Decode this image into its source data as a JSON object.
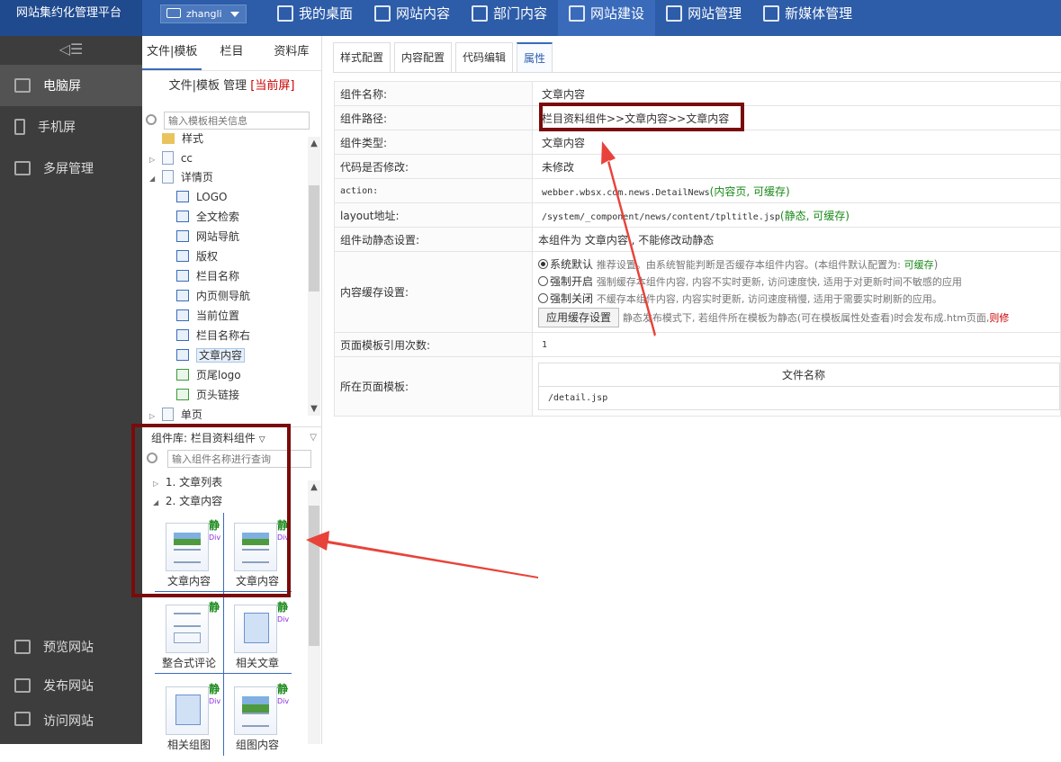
{
  "topbar": {
    "brand": "网站集约化管理平台",
    "user": "zhangli",
    "nav": [
      {
        "label": "我的桌面",
        "icon": "grid-icon"
      },
      {
        "label": "网站内容",
        "icon": "edit-icon"
      },
      {
        "label": "部门内容",
        "icon": "sitemap-icon"
      },
      {
        "label": "网站建设",
        "icon": "build-icon",
        "active": true
      },
      {
        "label": "网站管理",
        "icon": "monitor-gear-icon"
      },
      {
        "label": "新媒体管理",
        "icon": "media-icon"
      }
    ]
  },
  "left_menu": {
    "collapse_glyph": "◁☰",
    "items": [
      {
        "label": "电脑屏",
        "icon": "desktop-icon",
        "active": true
      },
      {
        "label": "手机屏",
        "icon": "phone-icon"
      },
      {
        "label": "多屏管理",
        "icon": "multi-screen-icon"
      }
    ],
    "bottom": [
      {
        "label": "预览网站",
        "icon": "preview-icon"
      },
      {
        "label": "发布网站",
        "icon": "publish-icon"
      },
      {
        "label": "访问网站",
        "icon": "visit-icon"
      }
    ]
  },
  "mid": {
    "tabs": [
      "文件|模板",
      "栏目",
      "资料库"
    ],
    "title": "文件|模板 管理",
    "title_current": "[当前屏]",
    "search_placeholder": "输入模板相关信息",
    "tree": [
      {
        "label": "样式",
        "type": "folder"
      },
      {
        "label": "cc",
        "type": "file",
        "toggle": "▷"
      },
      {
        "label": "详情页",
        "type": "file",
        "toggle": "◢"
      },
      {
        "label": "LOGO",
        "type": "comp"
      },
      {
        "label": "全文检索",
        "type": "comp"
      },
      {
        "label": "网站导航",
        "type": "comp"
      },
      {
        "label": "版权",
        "type": "comp"
      },
      {
        "label": "栏目名称",
        "type": "comp"
      },
      {
        "label": "内页侧导航",
        "type": "comp"
      },
      {
        "label": "当前位置",
        "type": "comp"
      },
      {
        "label": "栏目名称右",
        "type": "comp"
      },
      {
        "label": "文章内容",
        "type": "comp",
        "selected": true
      },
      {
        "label": "页尾logo",
        "type": "green"
      },
      {
        "label": "页头链接",
        "type": "green"
      },
      {
        "label": "单页",
        "type": "file",
        "toggle": "▷"
      }
    ],
    "complib_label": "组件库: 栏目资料组件",
    "complib_search_placeholder": "输入组件名称进行查询",
    "complib_tree": [
      {
        "toggle": "▷",
        "label": "1. 文章列表"
      },
      {
        "toggle": "◢",
        "label": "2. 文章内容"
      }
    ],
    "cards": [
      {
        "label": "文章内容",
        "badge": "静",
        "sub": "Div",
        "kind": "article"
      },
      {
        "label": "文章内容",
        "badge": "静",
        "sub": "Div",
        "kind": "article"
      },
      {
        "label": "整合式评论",
        "badge": "静",
        "sub": "",
        "kind": "form"
      },
      {
        "label": "相关文章",
        "badge": "静",
        "sub": "Div",
        "kind": "book"
      },
      {
        "label": "相关组图",
        "badge": "静",
        "sub": "Div",
        "kind": "book"
      },
      {
        "label": "组图内容",
        "badge": "静",
        "sub": "Div",
        "kind": "gallery"
      }
    ]
  },
  "right": {
    "tabs": [
      "样式配置",
      "内容配置",
      "代码编辑",
      "属性"
    ],
    "active_tab": "属性",
    "props": {
      "name_label": "组件名称:",
      "name_value": "文章内容",
      "path_label": "组件路径:",
      "path_value": "栏目资料组件>>文章内容>>文章内容",
      "type_label": "组件类型:",
      "type_value": "文章内容",
      "modified_label": "代码是否修改:",
      "modified_value": "未修改",
      "action_label": "action:",
      "action_value": "webber.wbsx.com.news.DetailNews",
      "action_note": "(内容页, 可缓存)",
      "layout_label": "layout地址:",
      "layout_value": "/system/_component/news/content/tpltitle.jsp",
      "layout_note": "(静态, 可缓存)",
      "dyn_label": "组件动静态设置:",
      "dyn_value": "本组件为 文章内容 , 不能修改动静态",
      "cache_label": "内容缓存设置:",
      "cache_options": [
        {
          "label": "系统默认",
          "desc": "推荐设置。由系统智能判断是否缓存本组件内容。(本组件默认配置为:",
          "note": "可缓存",
          "tail": ")",
          "checked": true
        },
        {
          "label": "强制开启",
          "desc": "强制缓存本组件内容, 内容不实时更新, 访问速度快, 适用于对更新时间不敏感的应用"
        },
        {
          "label": "强制关闭",
          "desc": "不缓存本组件内容, 内容实时更新, 访问速度稍慢, 适用于需要实时刷新的应用。"
        }
      ],
      "cache_button": "应用缓存设置",
      "cache_button_note": "静态发布模式下, 若组件所在模板为静态(可在模板属性处查看)时会发布成.htm页面,",
      "cache_button_note_red": "则修",
      "refcount_label": "页面模板引用次数:",
      "refcount_value": "1",
      "pages_label": "所在页面模板:",
      "pages_header": "文件名称",
      "pages_value": "/detail.jsp"
    }
  },
  "colors": {
    "topbar": "#2d5ca8",
    "sidebar": "#3d3d3d",
    "highlight_box": "#7a0b0b",
    "arrow": "#e8433a"
  }
}
